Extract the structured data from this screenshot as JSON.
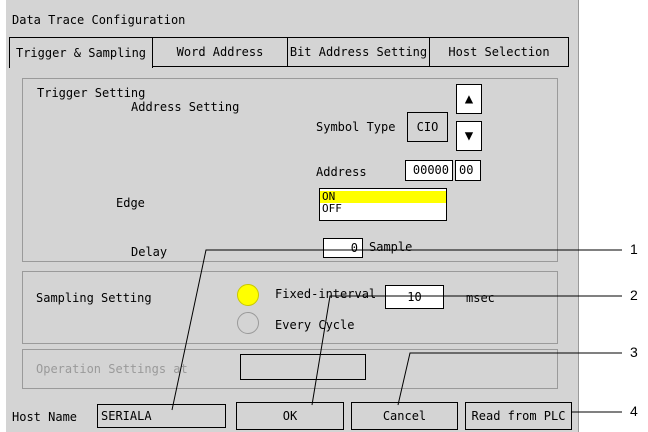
{
  "window": {
    "title": "Data Trace Configuration"
  },
  "tabs": [
    {
      "label": "Trigger & Sampling"
    },
    {
      "label": "Word Address"
    },
    {
      "label": "Bit Address Setting"
    },
    {
      "label": "Host Selection"
    }
  ],
  "trigger": {
    "section_label": "Trigger Setting",
    "address_setting_label": "Address Setting",
    "symbol_type_label": "Symbol Type",
    "symbol_type_value": "CIO",
    "up_arrow": "▲",
    "down_arrow": "▼",
    "address_label": "Address",
    "address_word": "00000",
    "address_bit": "00",
    "edge_label": "Edge",
    "edge_options": [
      "ON",
      "OFF"
    ],
    "edge_selected": "ON",
    "delay_label": "Delay",
    "delay_value": "0",
    "delay_unit": "Sample"
  },
  "sampling": {
    "section_label": "Sampling Setting",
    "fixed_interval_label": "Fixed-interval",
    "fixed_interval_value": "10",
    "interval_unit": "msec",
    "every_cycle_label": "Every Cycle",
    "selected": "Fixed-interval"
  },
  "operation": {
    "label": "Operation Settings at",
    "value": ""
  },
  "footer": {
    "host_name_label": "Host Name",
    "host_name_value": "SERIALA",
    "ok_label": "OK",
    "cancel_label": "Cancel",
    "read_label": "Read from PLC"
  },
  "callouts": [
    "1",
    "2",
    "3",
    "4"
  ],
  "colors": {
    "selected": "#ffff00",
    "background": "#d4d4d4",
    "disabled_text": "#9a9a9a"
  }
}
